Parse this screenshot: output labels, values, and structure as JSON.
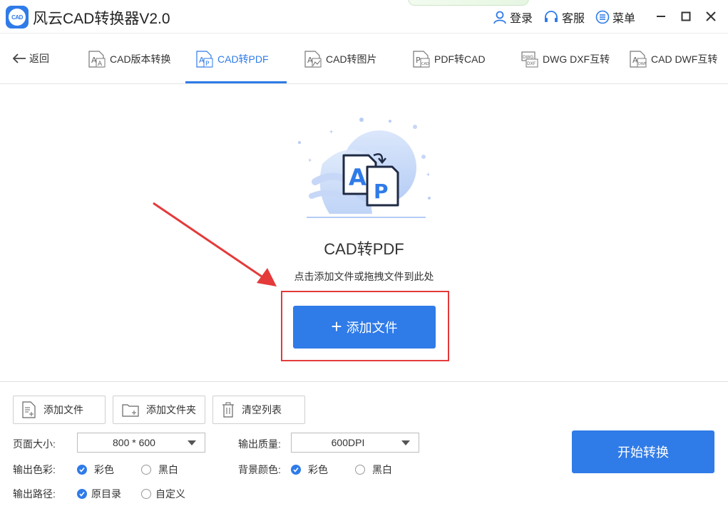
{
  "app": {
    "title": "风云CAD转换器V2.0",
    "logo_text": "CAD"
  },
  "topbar": {
    "login": "登录",
    "service": "客服",
    "menu": "菜单"
  },
  "nav": {
    "back": "返回",
    "tabs": [
      {
        "label": "CAD版本转换",
        "active": false
      },
      {
        "label": "CAD转PDF",
        "active": true
      },
      {
        "label": "CAD转图片",
        "active": false
      },
      {
        "label": "PDF转CAD",
        "active": false
      },
      {
        "label": "DWG DXF互转",
        "active": false
      },
      {
        "label": "CAD DWF互转",
        "active": false
      }
    ]
  },
  "main": {
    "title": "CAD转PDF",
    "hint": "点击添加文件或拖拽文件到此处",
    "add_button": "添加文件",
    "add_button_symbol": "+"
  },
  "toolbar": {
    "add_file": "添加文件",
    "add_folder": "添加文件夹",
    "clear_list": "清空列表"
  },
  "settings": {
    "page_size_label": "页面大小:",
    "page_size_value": "800 * 600",
    "quality_label": "输出质量:",
    "quality_value": "600DPI",
    "output_color_label": "输出色彩:",
    "output_color_options": [
      "彩色",
      "黑白"
    ],
    "output_color_selected": "彩色",
    "bg_color_label": "背景颜色:",
    "bg_color_options": [
      "彩色",
      "黑白"
    ],
    "bg_color_selected": "彩色",
    "output_path_label": "输出路径:",
    "output_path_options": [
      "原目录",
      "自定义"
    ],
    "output_path_selected": "原目录"
  },
  "start_button": "开始转换",
  "colors": {
    "accent": "#2f7be8",
    "highlight_red": "#e43a3a"
  }
}
